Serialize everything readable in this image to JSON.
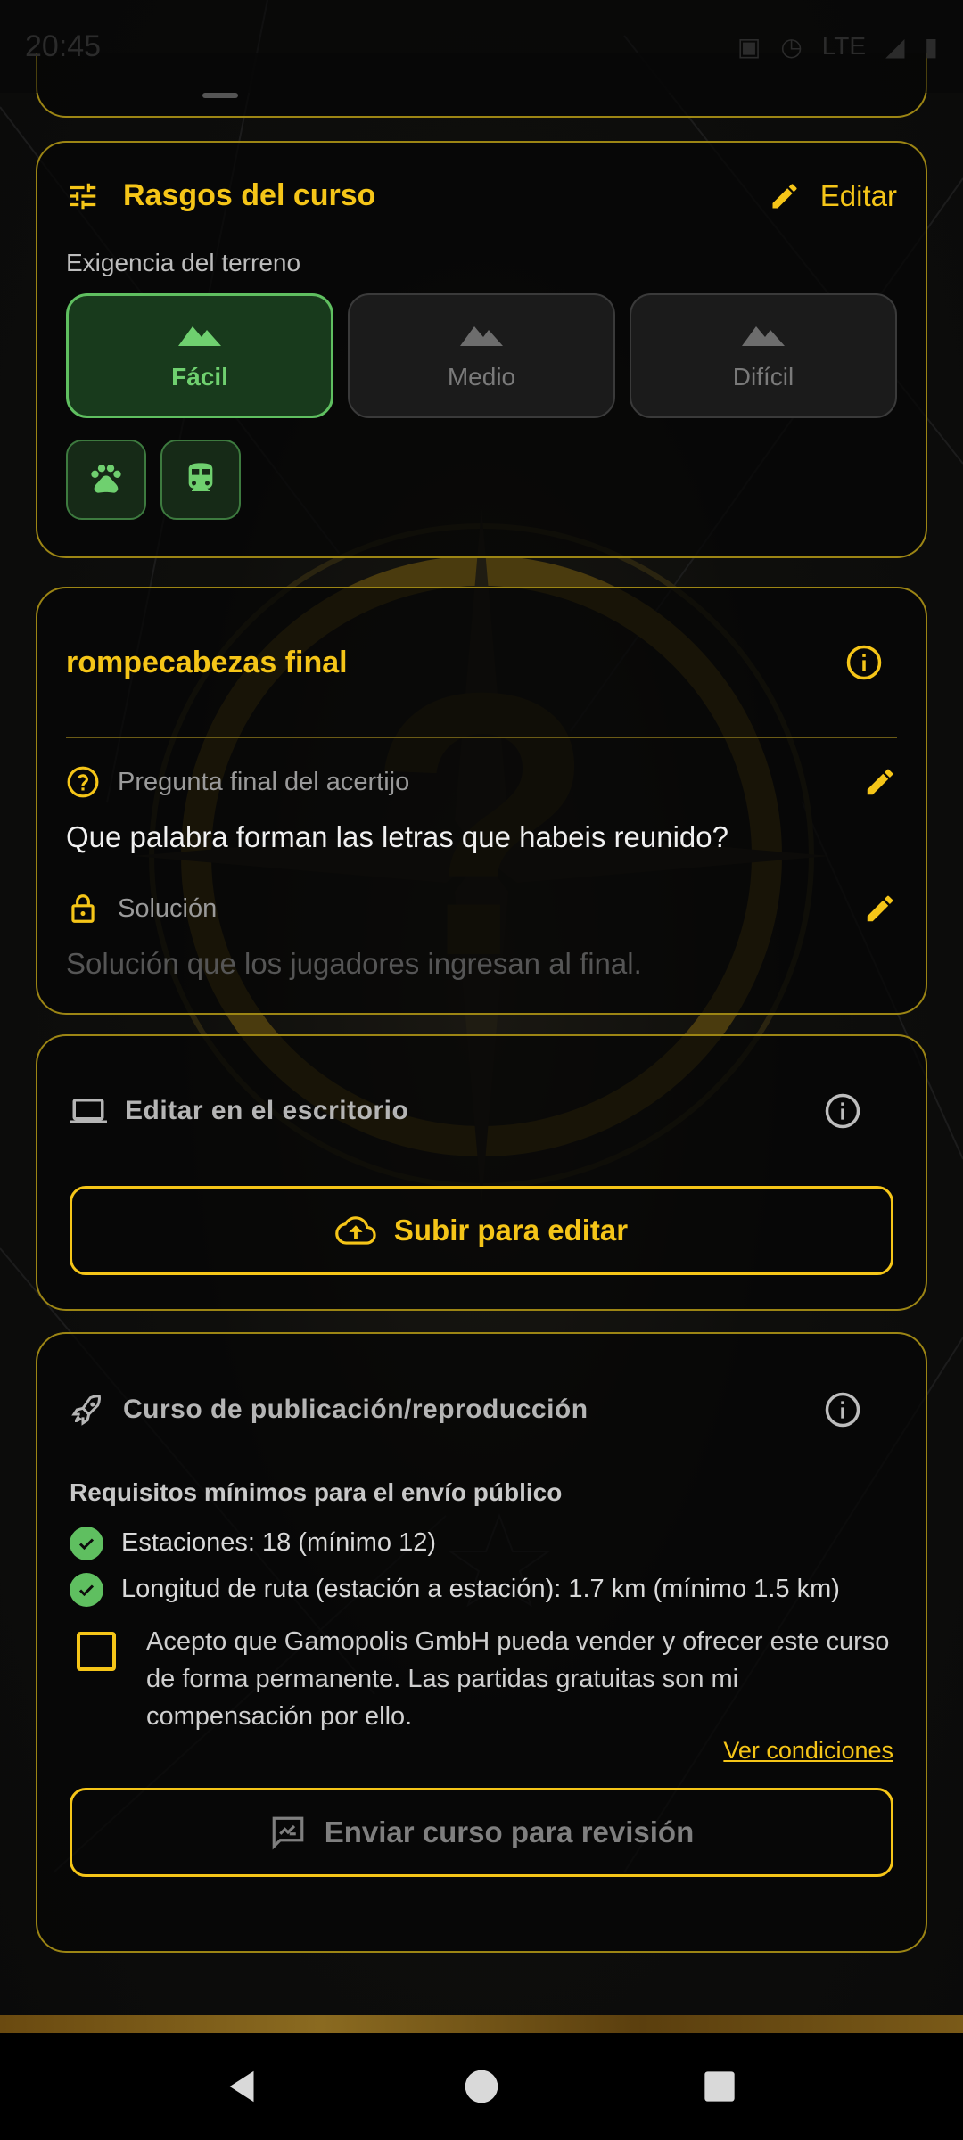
{
  "status_bar": {
    "time": "20:45",
    "network": "LTE"
  },
  "course_traits": {
    "title": "Rasgos del curso",
    "edit_label": "Editar",
    "terrain_label": "Exigencia del terreno",
    "difficulty_options": [
      {
        "label": "Fácil",
        "selected": true
      },
      {
        "label": "Medio",
        "selected": false
      },
      {
        "label": "Difícil",
        "selected": false
      }
    ],
    "features": [
      "paw-icon",
      "train-icon"
    ]
  },
  "final_puzzle": {
    "title": "rompecabezas final",
    "question_label": "Pregunta final del acertijo",
    "question_value": "Que palabra forman las letras que habeis reunido?",
    "solution_label": "Solución",
    "solution_placeholder": "Solución que los jugadores ingresan al final."
  },
  "desktop_edit": {
    "title": "Editar en el escritorio",
    "upload_button": "Subir para editar"
  },
  "publish": {
    "title": "Curso de publicación/reproducción",
    "requirements_title": "Requisitos mínimos para el envío público",
    "requirements": [
      "Estaciones: 18 (mínimo 12)",
      "Longitud de ruta (estación a estación): 1.7 km (mínimo 1.5 km)"
    ],
    "accept_text": "Acepto que Gamopolis GmbH pueda vender y ofrecer este curso de forma permanente. Las partidas gratuitas son mi compensación por ello.",
    "conditions_link": "Ver condiciones",
    "submit_button": "Enviar curso para revisión"
  },
  "colors": {
    "accent": "#f5c518",
    "success": "#5fbf60",
    "card_border": "#9c8514"
  }
}
